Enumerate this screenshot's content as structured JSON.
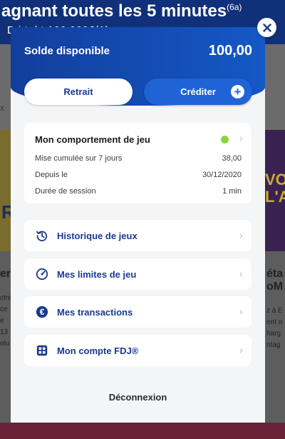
{
  "background": {
    "banner_title": "agnant toutes les 5 minutes",
    "banner_sup": "(6a)",
    "banner_sub": "D   i         t   d     t  100 000€(1)",
    "left_card_text": "R",
    "right_card_text": "VOU L'A",
    "left_heading": "er",
    "left_lines": [
      "ctre",
      "ce",
      "e 13",
      "olu"
    ],
    "right_heading": "éta oM",
    "right_lines": [
      "z à E",
      "ent o",
      "harg",
      "ntag"
    ],
    "side_text": "x"
  },
  "panel": {
    "balance_label": "Solde disponible",
    "balance_value": "100,00",
    "withdraw_label": "Retrait",
    "credit_label": "Créditer",
    "behavior": {
      "title": "Mon comportement de jeu",
      "status_color": "#8fd13e",
      "rows": [
        {
          "label": "Mise cumulée sur 7 jours",
          "value": "38,00"
        },
        {
          "label": "Depuis le",
          "value": "30/12/2020"
        },
        {
          "label": "Durée de session",
          "value": "1 min"
        }
      ]
    },
    "menu": [
      {
        "label": "Historique de jeux",
        "icon": "history-icon"
      },
      {
        "label": "Mes limites de jeu",
        "icon": "gauge-icon"
      },
      {
        "label": "Mes transactions",
        "icon": "euro-icon"
      },
      {
        "label": "Mon compte FDJ®",
        "icon": "account-grid-icon"
      }
    ],
    "logout_label": "Déconnexion"
  },
  "colors": {
    "header_blue": "#123e9c",
    "accent_blue": "#1f63d6",
    "link_blue": "#1a3a8f"
  }
}
